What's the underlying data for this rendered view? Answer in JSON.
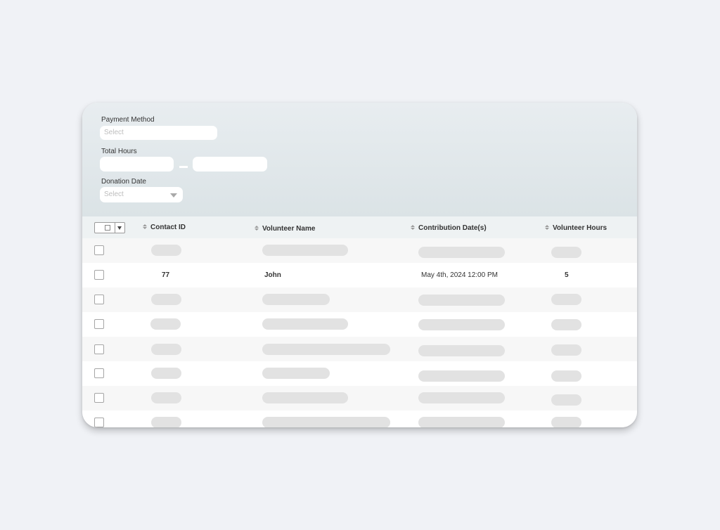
{
  "filters": {
    "payment_method": {
      "label": "Payment Method",
      "placeholder": "Select"
    },
    "total_hours": {
      "label": "Total Hours",
      "min_value": "",
      "max_value": ""
    },
    "donation_date": {
      "label": "Donation Date",
      "placeholder": "Select"
    }
  },
  "table": {
    "columns": [
      {
        "label": "Contact ID"
      },
      {
        "label": "Volunteer Name"
      },
      {
        "label": "Contribution Date(s)"
      },
      {
        "label": "Volunteer Hours"
      }
    ],
    "rows": [
      {
        "loaded": false
      },
      {
        "loaded": true,
        "contact_id": "77",
        "volunteer_name": "John",
        "contribution_date": "May 4th, 2024 12:00 PM",
        "volunteer_hours": "5"
      },
      {
        "loaded": false
      },
      {
        "loaded": false
      },
      {
        "loaded": false
      },
      {
        "loaded": false
      },
      {
        "loaded": false
      },
      {
        "loaded": false
      }
    ]
  },
  "icons": {
    "select_all": "select-all-checkbox",
    "sort": "sort-arrows-icon",
    "dropdown": "chevron-down-icon"
  }
}
